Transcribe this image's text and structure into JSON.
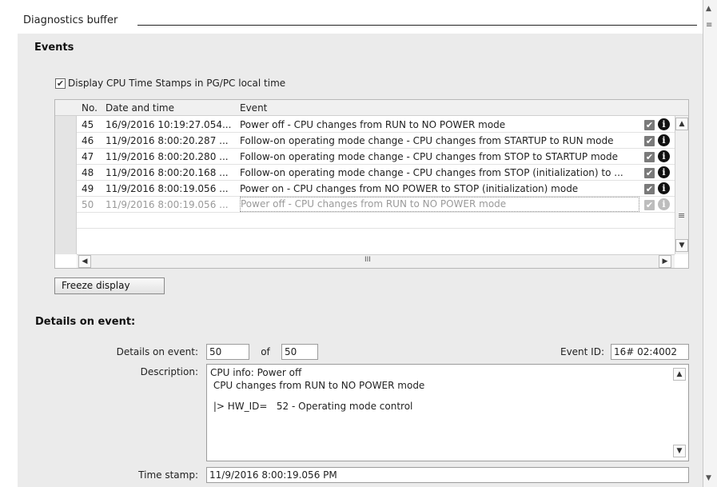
{
  "panel": {
    "title": "Diagnostics buffer"
  },
  "events": {
    "title": "Events",
    "display_cpu_timestamps": {
      "label": "Display CPU Time Stamps in PG/PC local time",
      "checked": true
    },
    "columns": {
      "no": "No.",
      "datetime": "Date and time",
      "event": "Event"
    },
    "rows": [
      {
        "no": "45",
        "datetime": "16/9/2016 10:19:27.054...",
        "event": "Power off - CPU changes from RUN to NO POWER mode"
      },
      {
        "no": "46",
        "datetime": "11/9/2016 8:00:20.287 ...",
        "event": "Follow-on operating mode change - CPU changes from STARTUP to RUN mode"
      },
      {
        "no": "47",
        "datetime": "11/9/2016 8:00:20.280 ...",
        "event": "Follow-on operating mode change - CPU changes from STOP to STARTUP mode"
      },
      {
        "no": "48",
        "datetime": "11/9/2016 8:00:20.168 ...",
        "event": "Follow-on operating mode change - CPU changes from STOP (initialization) to ..."
      },
      {
        "no": "49",
        "datetime": "11/9/2016 8:00:19.056 ...",
        "event": "Power on - CPU changes from NO POWER to STOP (initialization) mode"
      },
      {
        "no": "50",
        "datetime": "11/9/2016 8:00:19.056 ...",
        "event": "Power off - CPU changes from RUN to NO POWER mode"
      }
    ],
    "hscroll_thumb": "III",
    "freeze_button": "Freeze display"
  },
  "details": {
    "title": "Details on event:",
    "details_label": "Details on event:",
    "current": "50",
    "of_label": "of",
    "total": "50",
    "event_id_label": "Event ID:",
    "event_id": "16# 02:4002",
    "description_label": "Description:",
    "description_lines": [
      "CPU info: Power off",
      " CPU changes from RUN to NO POWER mode",
      "",
      " |> HW_ID=   52 - Operating mode control"
    ],
    "timestamp_label": "Time stamp:",
    "timestamp": "11/9/2016 8:00:19.056 PM"
  }
}
